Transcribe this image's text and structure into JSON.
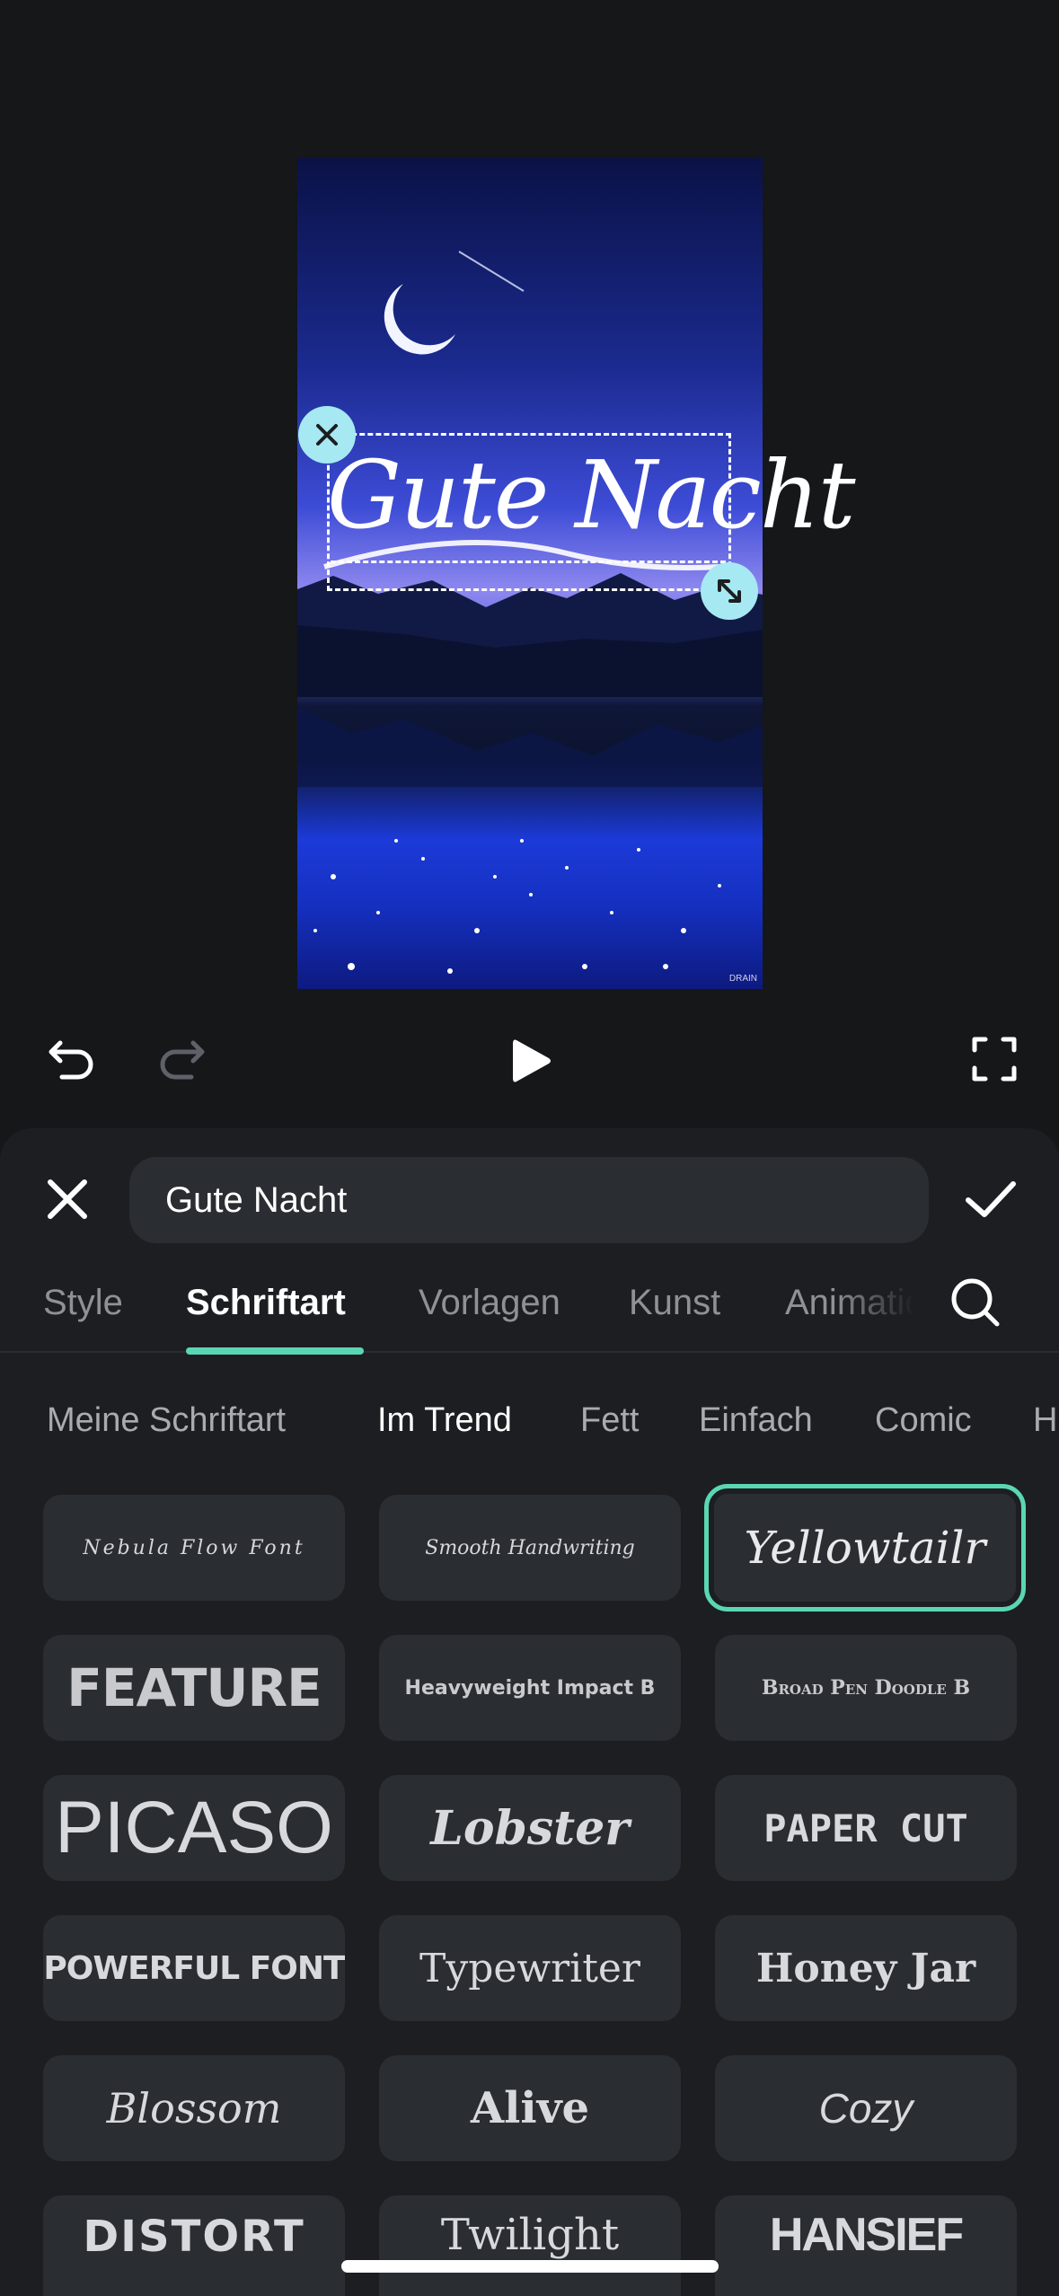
{
  "preview": {
    "overlay_text": "Gute Nacht",
    "watermark": "DRAIN"
  },
  "transport": {
    "undo_icon": "undo-icon",
    "redo_icon": "redo-icon",
    "play_icon": "play-icon",
    "fullscreen_icon": "fullscreen-icon"
  },
  "editor": {
    "text_value": "Gute Nacht"
  },
  "tabs": [
    {
      "label": "Style"
    },
    {
      "label": "Schriftart"
    },
    {
      "label": "Vorlagen"
    },
    {
      "label": "Kunst"
    },
    {
      "label": "Animatio"
    }
  ],
  "categories": [
    {
      "label": "Meine Schriftart"
    },
    {
      "label": "Im Trend"
    },
    {
      "label": "Fett"
    },
    {
      "label": "Einfach"
    },
    {
      "label": "Comic"
    },
    {
      "label": "H"
    }
  ],
  "fonts": [
    {
      "label": "Nebula Flow Font"
    },
    {
      "label": "Smooth Handwriting"
    },
    {
      "label": "Yellowtailr"
    },
    {
      "label": "FEATURE"
    },
    {
      "label": "Heavyweight Impact B"
    },
    {
      "label": "Broad Pen Doodle B"
    },
    {
      "label": "PICASO"
    },
    {
      "label": "Lobster"
    },
    {
      "label": "PAPER CUT"
    },
    {
      "label": "POWERFUL FONT"
    },
    {
      "label": "Typewriter"
    },
    {
      "label": "Honey Jar"
    },
    {
      "label": "Blossom"
    },
    {
      "label": "Alive"
    },
    {
      "label": "Cozy"
    },
    {
      "label": "DISTORT"
    },
    {
      "label": "Twilight"
    },
    {
      "label": "HANSIEF"
    }
  ],
  "colors": {
    "accent": "#5ad6b4",
    "handle": "#a6e9f2",
    "sheet_bg": "#1c1e21",
    "tile_bg": "#2a2d31"
  }
}
